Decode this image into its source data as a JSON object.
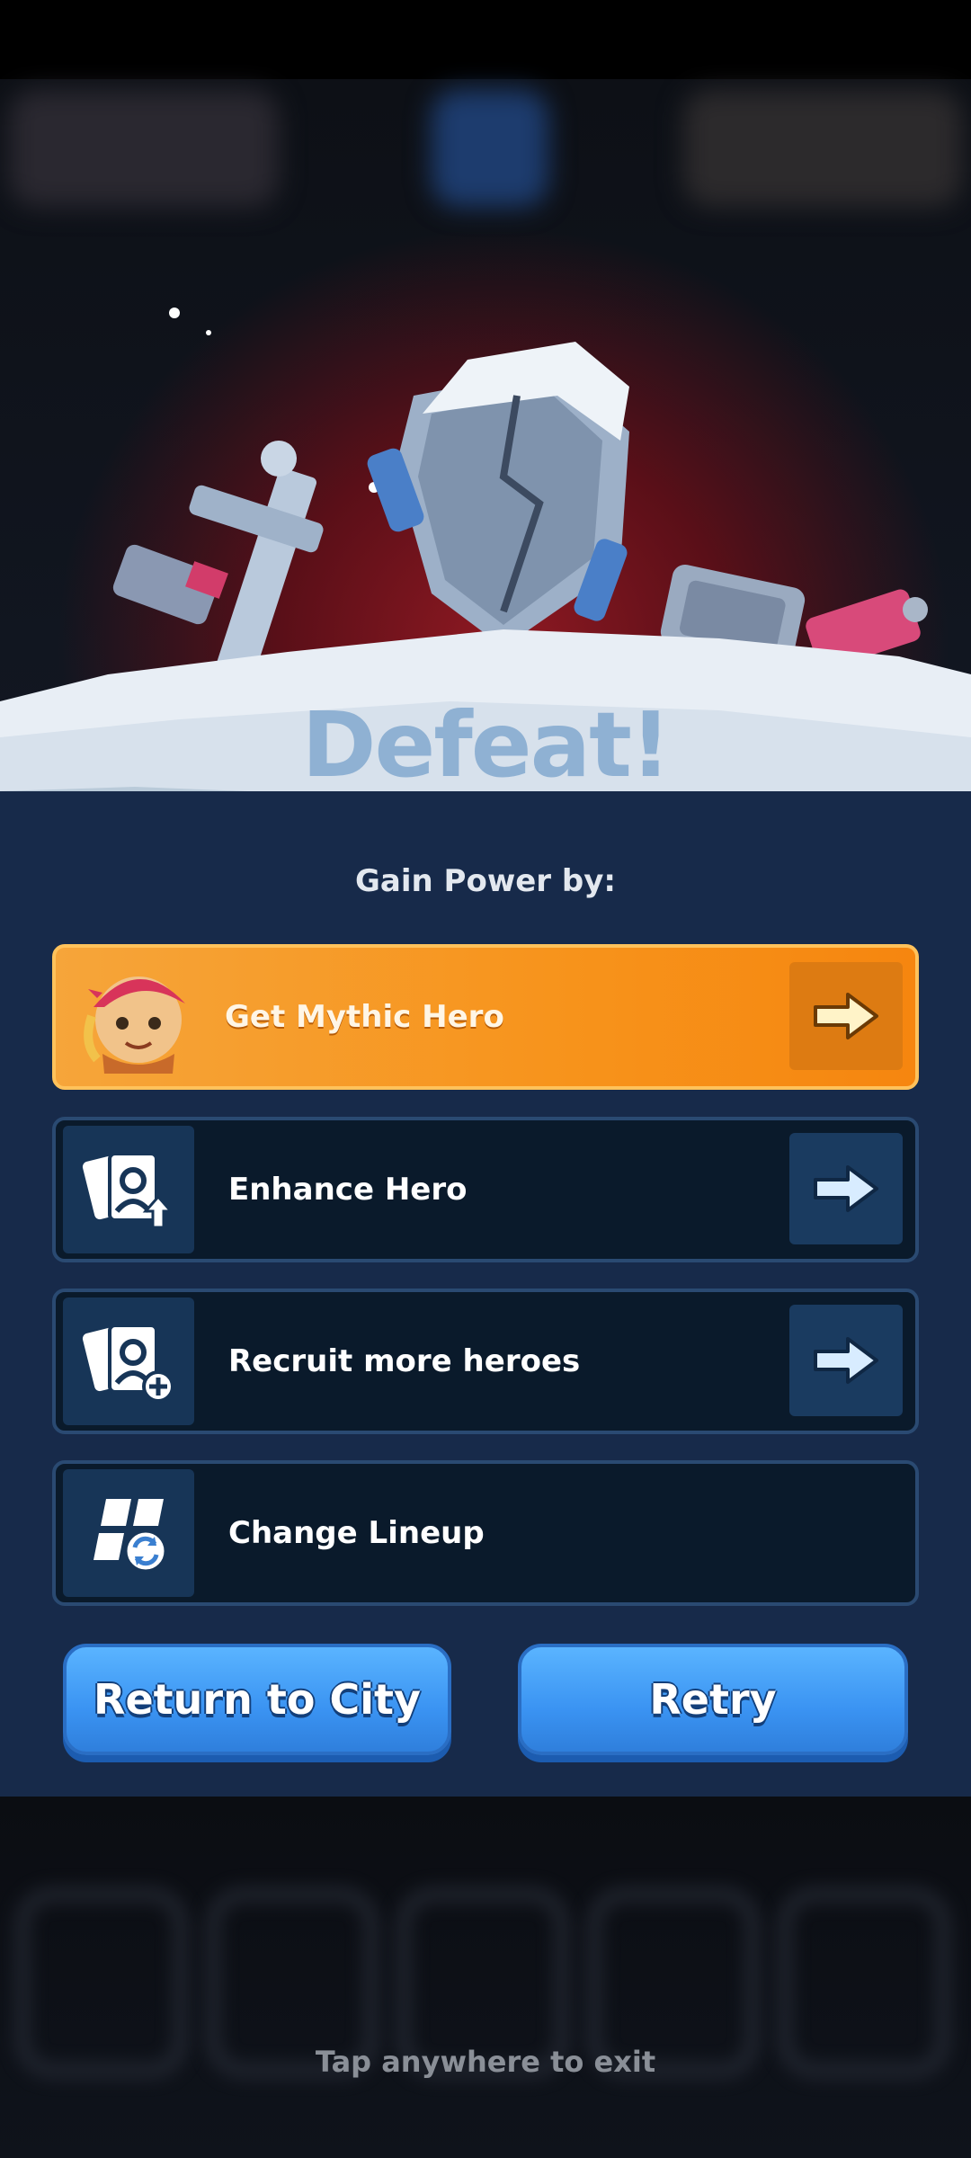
{
  "result": {
    "title": "Defeat!",
    "subtitle": "Gain Power by:"
  },
  "options": [
    {
      "label": "Get Mythic Hero",
      "icon": "mythic-hero-portrait-icon",
      "has_arrow": true,
      "highlight": "#f7931b"
    },
    {
      "label": "Enhance Hero",
      "icon": "cards-upgrade-icon",
      "has_arrow": true
    },
    {
      "label": "Recruit more heroes",
      "icon": "cards-add-icon",
      "has_arrow": true
    },
    {
      "label": "Change Lineup",
      "icon": "lineup-swap-icon",
      "has_arrow": false
    }
  ],
  "buttons": {
    "return_label": "Return to City",
    "retry_label": "Retry"
  },
  "footer": {
    "exit_hint": "Tap anywhere to exit"
  },
  "colors": {
    "panel": "#172a4a",
    "button_blue": "#3a93f2",
    "title": "#8fb1d3"
  }
}
